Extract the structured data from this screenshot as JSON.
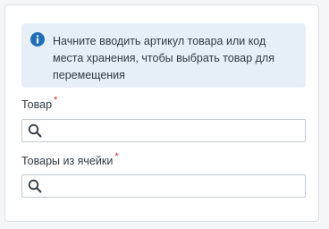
{
  "info": {
    "icon": "info-icon",
    "message": "Начните вводить артикул товара или код места хранения, чтобы выбрать товар для перемещения"
  },
  "fields": {
    "product": {
      "label": "Товар",
      "required_mark": "*",
      "icon": "search-icon",
      "value": "",
      "placeholder": ""
    },
    "cell_products": {
      "label": "Товары из ячейки",
      "required_mark": "*",
      "icon": "search-icon",
      "value": "",
      "placeholder": ""
    }
  },
  "colors": {
    "info_background": "#e6eff7",
    "info_icon": "#1f6fb5",
    "required": "#d92b2b",
    "border": "#c4c9cf"
  }
}
